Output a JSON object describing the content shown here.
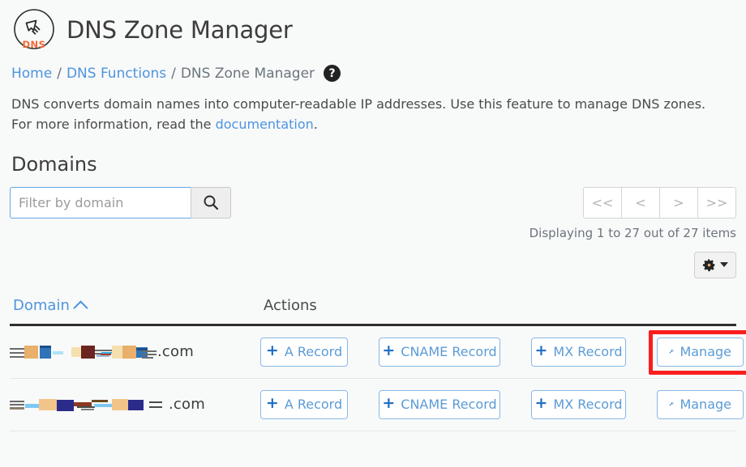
{
  "header": {
    "title": "DNS Zone Manager",
    "logo_text": "DNS",
    "logo_icon": "hand-pointer-icon"
  },
  "breadcrumb": {
    "home": "Home",
    "parent": "DNS Functions",
    "current": "DNS Zone Manager",
    "separator": "/",
    "help_icon_label": "?"
  },
  "description": {
    "line1": "DNS converts domain names into computer-readable IP addresses. Use this feature to manage DNS zones.",
    "line2_prefix": "For more information, read the ",
    "link": "documentation",
    "line2_suffix": "."
  },
  "domains_section": {
    "title": "Domains",
    "search": {
      "placeholder": "Filter by domain",
      "value": "",
      "button_icon": "search-icon"
    },
    "pagination": {
      "first": "<<",
      "previous": "<",
      "next": ">",
      "last": ">>",
      "status": "Displaying 1 to 27 out of 27 items"
    },
    "settings": {
      "icon": "gear-icon",
      "caret": "chevron-down-icon"
    }
  },
  "table": {
    "columns": [
      {
        "label": "Domain",
        "sortable": true,
        "sort_direction": "ascending"
      },
      {
        "label": "Actions",
        "sortable": false
      }
    ],
    "rows": [
      {
        "domain_redacted": true,
        "domain_tld": ".com",
        "actions": [
          {
            "label": "A Record",
            "icon": "plus-icon"
          },
          {
            "label": "CNAME Record",
            "icon": "plus-icon"
          },
          {
            "label": "MX Record",
            "icon": "plus-icon"
          },
          {
            "label": "Manage",
            "icon": "wrench-icon",
            "highlighted": true
          }
        ]
      },
      {
        "domain_redacted": true,
        "domain_tld": ".com",
        "actions": [
          {
            "label": "A Record",
            "icon": "plus-icon"
          },
          {
            "label": "CNAME Record",
            "icon": "plus-icon"
          },
          {
            "label": "MX Record",
            "icon": "plus-icon"
          },
          {
            "label": "Manage",
            "icon": "wrench-icon",
            "highlighted": false
          }
        ]
      }
    ]
  },
  "colors": {
    "link": "#4d94e0",
    "button_border": "#8ab8e8",
    "button_text": "#5b9bd5",
    "plus_icon": "#1f6fc4",
    "annotation": "#f91e1e",
    "page_background": "#f8f9f9",
    "header_rule": "#2e2e2e",
    "logo_accent": "#f26b38"
  }
}
